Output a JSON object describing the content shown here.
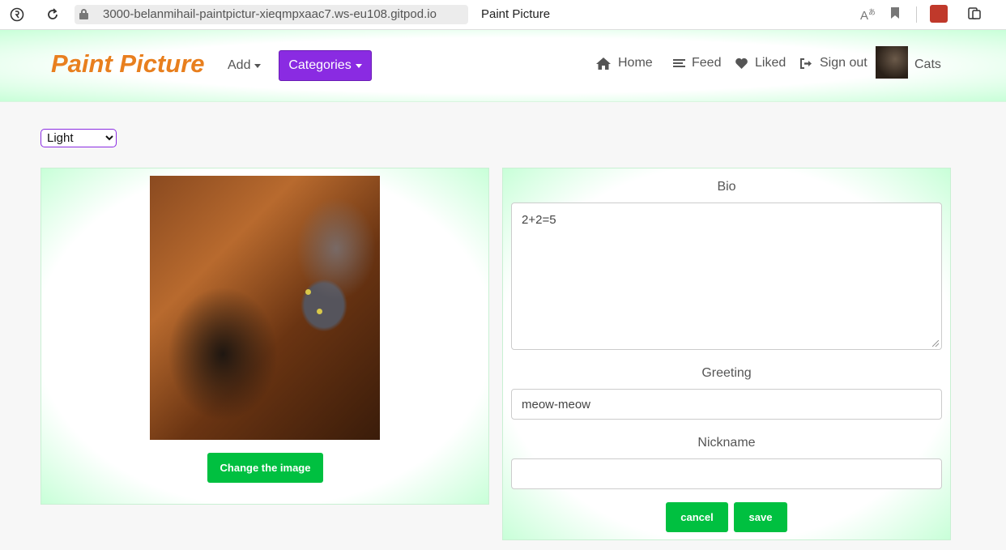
{
  "browser": {
    "url": "3000-belanmihail-paintpictur-xieqmpxaac7.ws-eu108.gitpod.io",
    "tab_title": "Paint Picture"
  },
  "navbar": {
    "brand": "Paint Picture",
    "add_label": "Add",
    "categories_label": "Categories",
    "links": {
      "home": "Home",
      "feed": "Feed",
      "liked": "Liked",
      "signout": "Sign out"
    },
    "user_name": "Cats"
  },
  "theme": {
    "selected": "Light",
    "options": [
      "Light"
    ]
  },
  "profile": {
    "change_image_label": "Change the image",
    "bio_label": "Bio",
    "bio_value": "2+2=5",
    "greeting_label": "Greeting",
    "greeting_value": "meow-meow",
    "nickname_label": "Nickname",
    "nickname_value": "",
    "cancel_label": "cancel",
    "save_label": "save"
  },
  "colors": {
    "brand": "#e87f1e",
    "accent_purple": "#8a2be2",
    "button_green": "#00c040",
    "panel_glow": "#c8ffd8"
  }
}
